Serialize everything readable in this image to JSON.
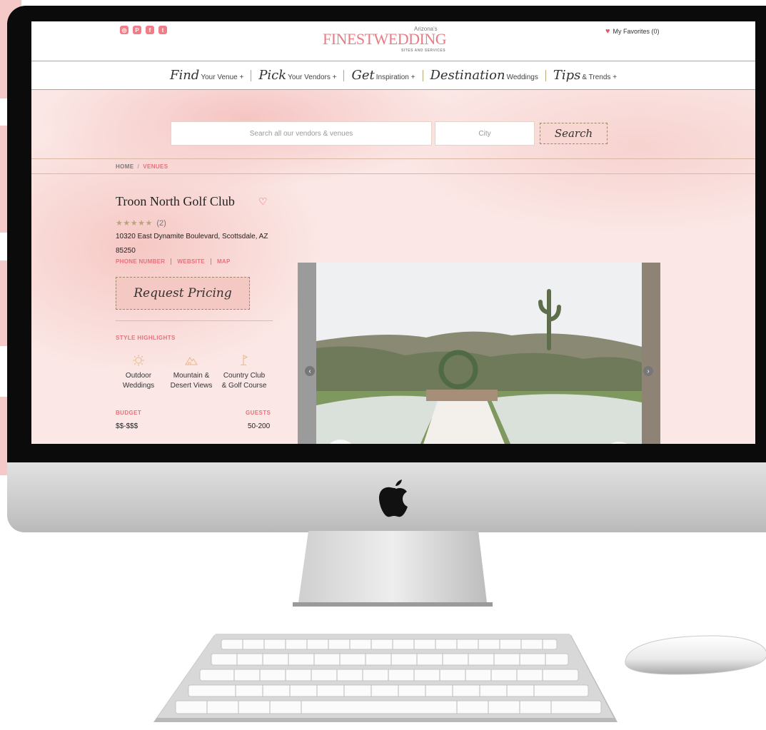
{
  "site": {
    "brand_top": "Arizona's",
    "brand_main": "FINESTWEDDING",
    "brand_sub": "SITES AND SERVICES",
    "favorites_label": "My Favorites (0)",
    "social_icons": [
      "instagram-icon",
      "pinterest-icon",
      "facebook-icon",
      "twitter-icon"
    ]
  },
  "nav": [
    {
      "script": "Find",
      "rest": "Your Venue +"
    },
    {
      "script": "Pick",
      "rest": "Your Vendors +"
    },
    {
      "script": "Get",
      "rest": "Inspiration +"
    },
    {
      "script": "Destination",
      "rest": "Weddings"
    },
    {
      "script": "Tips",
      "rest": "& Trends +"
    }
  ],
  "search": {
    "placeholder": "Search all our vendors & venues",
    "city_placeholder": "City",
    "button_label": "Search"
  },
  "breadcrumb": {
    "home": "HOME",
    "separator": "/",
    "current": "VENUES"
  },
  "venue": {
    "name": "Troon North Golf Club",
    "rating_stars": "★★★★★",
    "rating": 5,
    "review_count": "(2)",
    "address_line1": "10320 East Dynamite Boulevard, Scottsdale, AZ",
    "address_line2": "85250",
    "links": [
      "PHONE NUMBER",
      "WEBSITE",
      "MAP"
    ],
    "request_button": "Request Pricing",
    "style_title": "STYLE HIGHLIGHTS",
    "highlights": [
      {
        "line1": "Outdoor",
        "line2": "Weddings",
        "icon": "sun-icon"
      },
      {
        "line1": "Mountain &",
        "line2": "Desert Views",
        "icon": "mountain-icon"
      },
      {
        "line1": "Country Club",
        "line2": "& Golf Course",
        "icon": "golf-flag-icon"
      }
    ],
    "budget_label": "BUDGET",
    "budget_value": "$$-$$$",
    "guests_label": "GUESTS",
    "guests_value": "50-200"
  },
  "colors": {
    "accent_pink": "#e8707c",
    "gold_line": "#b8a77b",
    "hero_pink": "#fbe8e6",
    "button_pink": "#f4c8c3"
  }
}
